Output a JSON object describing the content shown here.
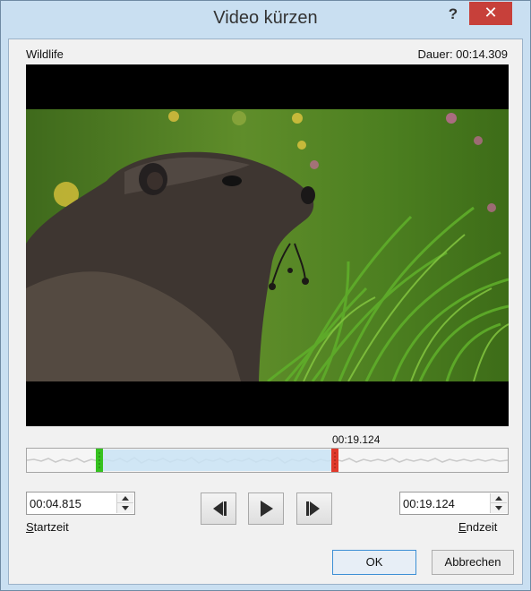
{
  "window": {
    "title": "Video kürzen",
    "help_glyph": "?",
    "close_glyph": "✕"
  },
  "video": {
    "name": "Wildlife",
    "duration_text": "Dauer: 00:14.309"
  },
  "timeline": {
    "end_marker_time": "00:19.124",
    "start_fraction": 0.15,
    "end_fraction": 0.64,
    "colors": {
      "selection": "#c9e3f5",
      "start_marker": "#35c21f",
      "end_marker": "#e0392b"
    }
  },
  "start": {
    "value": "00:04.815",
    "label_access_key": "S",
    "label_rest": "tartzeit"
  },
  "end": {
    "value": "00:19.124",
    "label_access_key": "E",
    "label_rest": "ndzeit"
  },
  "playback": {
    "previous_icon": "step-back-icon",
    "play_icon": "play-icon",
    "next_icon": "step-forward-icon"
  },
  "buttons": {
    "ok_label": "OK",
    "cancel_label": "Abbrechen"
  }
}
